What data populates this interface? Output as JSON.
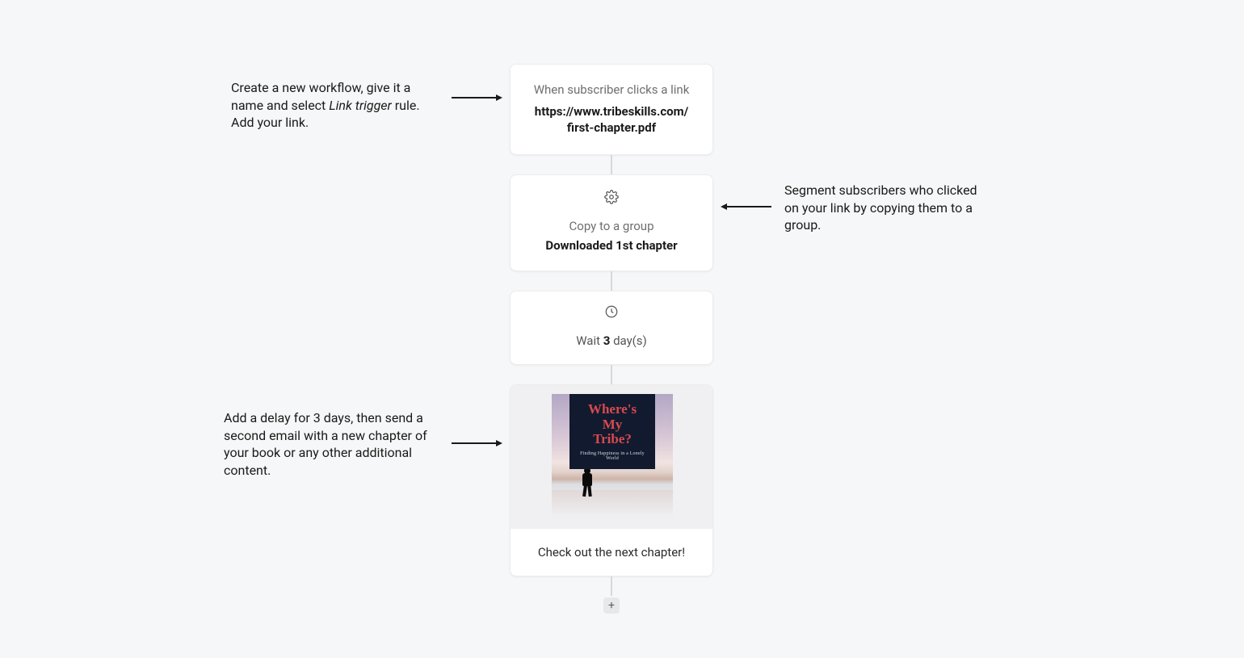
{
  "annotations": {
    "a1_part1": "Create a new workflow, give it a name and select ",
    "a1_italic": "Link trigger",
    "a1_part2": " rule. Add your link.",
    "a2": "Segment subscribers who clicked on your link by copying them to a group.",
    "a3": "Add a delay for 3 days, then send a second email with a new chapter of your book or any other additional content."
  },
  "workflow": {
    "trigger": {
      "label": "When subscriber clicks a link",
      "link_line1": "https://www.tribeskills.com/",
      "link_line2": "first-chapter.pdf"
    },
    "copy_to_group": {
      "label": "Copy to a group",
      "value": "Downloaded 1st chapter"
    },
    "wait": {
      "prefix": "Wait ",
      "days": "3",
      "suffix": " day(s)"
    },
    "email": {
      "subject": "Check out the next chapter!",
      "preview": {
        "title_l1": "Where's",
        "title_l2": "My",
        "title_l3": "Tribe?",
        "subtitle": "Finding Happiness in a Lonely World"
      }
    },
    "add_button_label": "+"
  }
}
